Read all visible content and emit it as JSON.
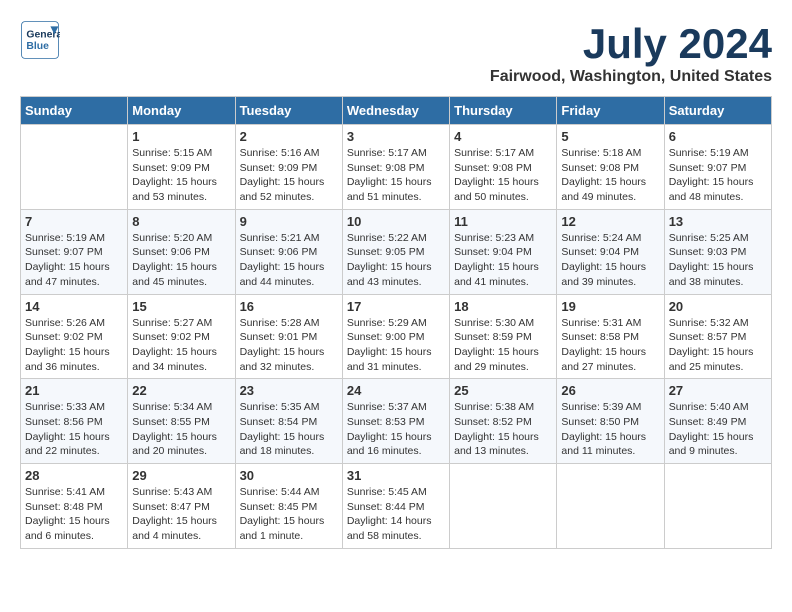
{
  "header": {
    "logo_line1": "General",
    "logo_line2": "Blue",
    "title": "July 2024",
    "subtitle": "Fairwood, Washington, United States"
  },
  "days_of_week": [
    "Sunday",
    "Monday",
    "Tuesday",
    "Wednesday",
    "Thursday",
    "Friday",
    "Saturday"
  ],
  "weeks": [
    [
      {
        "num": "",
        "text": ""
      },
      {
        "num": "1",
        "text": "Sunrise: 5:15 AM\nSunset: 9:09 PM\nDaylight: 15 hours\nand 53 minutes."
      },
      {
        "num": "2",
        "text": "Sunrise: 5:16 AM\nSunset: 9:09 PM\nDaylight: 15 hours\nand 52 minutes."
      },
      {
        "num": "3",
        "text": "Sunrise: 5:17 AM\nSunset: 9:08 PM\nDaylight: 15 hours\nand 51 minutes."
      },
      {
        "num": "4",
        "text": "Sunrise: 5:17 AM\nSunset: 9:08 PM\nDaylight: 15 hours\nand 50 minutes."
      },
      {
        "num": "5",
        "text": "Sunrise: 5:18 AM\nSunset: 9:08 PM\nDaylight: 15 hours\nand 49 minutes."
      },
      {
        "num": "6",
        "text": "Sunrise: 5:19 AM\nSunset: 9:07 PM\nDaylight: 15 hours\nand 48 minutes."
      }
    ],
    [
      {
        "num": "7",
        "text": "Sunrise: 5:19 AM\nSunset: 9:07 PM\nDaylight: 15 hours\nand 47 minutes."
      },
      {
        "num": "8",
        "text": "Sunrise: 5:20 AM\nSunset: 9:06 PM\nDaylight: 15 hours\nand 45 minutes."
      },
      {
        "num": "9",
        "text": "Sunrise: 5:21 AM\nSunset: 9:06 PM\nDaylight: 15 hours\nand 44 minutes."
      },
      {
        "num": "10",
        "text": "Sunrise: 5:22 AM\nSunset: 9:05 PM\nDaylight: 15 hours\nand 43 minutes."
      },
      {
        "num": "11",
        "text": "Sunrise: 5:23 AM\nSunset: 9:04 PM\nDaylight: 15 hours\nand 41 minutes."
      },
      {
        "num": "12",
        "text": "Sunrise: 5:24 AM\nSunset: 9:04 PM\nDaylight: 15 hours\nand 39 minutes."
      },
      {
        "num": "13",
        "text": "Sunrise: 5:25 AM\nSunset: 9:03 PM\nDaylight: 15 hours\nand 38 minutes."
      }
    ],
    [
      {
        "num": "14",
        "text": "Sunrise: 5:26 AM\nSunset: 9:02 PM\nDaylight: 15 hours\nand 36 minutes."
      },
      {
        "num": "15",
        "text": "Sunrise: 5:27 AM\nSunset: 9:02 PM\nDaylight: 15 hours\nand 34 minutes."
      },
      {
        "num": "16",
        "text": "Sunrise: 5:28 AM\nSunset: 9:01 PM\nDaylight: 15 hours\nand 32 minutes."
      },
      {
        "num": "17",
        "text": "Sunrise: 5:29 AM\nSunset: 9:00 PM\nDaylight: 15 hours\nand 31 minutes."
      },
      {
        "num": "18",
        "text": "Sunrise: 5:30 AM\nSunset: 8:59 PM\nDaylight: 15 hours\nand 29 minutes."
      },
      {
        "num": "19",
        "text": "Sunrise: 5:31 AM\nSunset: 8:58 PM\nDaylight: 15 hours\nand 27 minutes."
      },
      {
        "num": "20",
        "text": "Sunrise: 5:32 AM\nSunset: 8:57 PM\nDaylight: 15 hours\nand 25 minutes."
      }
    ],
    [
      {
        "num": "21",
        "text": "Sunrise: 5:33 AM\nSunset: 8:56 PM\nDaylight: 15 hours\nand 22 minutes."
      },
      {
        "num": "22",
        "text": "Sunrise: 5:34 AM\nSunset: 8:55 PM\nDaylight: 15 hours\nand 20 minutes."
      },
      {
        "num": "23",
        "text": "Sunrise: 5:35 AM\nSunset: 8:54 PM\nDaylight: 15 hours\nand 18 minutes."
      },
      {
        "num": "24",
        "text": "Sunrise: 5:37 AM\nSunset: 8:53 PM\nDaylight: 15 hours\nand 16 minutes."
      },
      {
        "num": "25",
        "text": "Sunrise: 5:38 AM\nSunset: 8:52 PM\nDaylight: 15 hours\nand 13 minutes."
      },
      {
        "num": "26",
        "text": "Sunrise: 5:39 AM\nSunset: 8:50 PM\nDaylight: 15 hours\nand 11 minutes."
      },
      {
        "num": "27",
        "text": "Sunrise: 5:40 AM\nSunset: 8:49 PM\nDaylight: 15 hours\nand 9 minutes."
      }
    ],
    [
      {
        "num": "28",
        "text": "Sunrise: 5:41 AM\nSunset: 8:48 PM\nDaylight: 15 hours\nand 6 minutes."
      },
      {
        "num": "29",
        "text": "Sunrise: 5:43 AM\nSunset: 8:47 PM\nDaylight: 15 hours\nand 4 minutes."
      },
      {
        "num": "30",
        "text": "Sunrise: 5:44 AM\nSunset: 8:45 PM\nDaylight: 15 hours\nand 1 minute."
      },
      {
        "num": "31",
        "text": "Sunrise: 5:45 AM\nSunset: 8:44 PM\nDaylight: 14 hours\nand 58 minutes."
      },
      {
        "num": "",
        "text": ""
      },
      {
        "num": "",
        "text": ""
      },
      {
        "num": "",
        "text": ""
      }
    ]
  ]
}
